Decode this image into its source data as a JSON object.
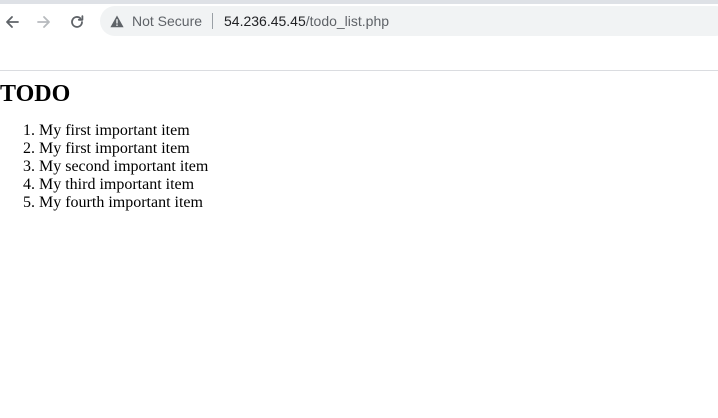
{
  "browser": {
    "security_label": "Not Secure",
    "url_host": "54.236.45.45",
    "url_path": "/todo_list.php",
    "icons": {
      "back": "arrow-left-icon",
      "forward": "arrow-right-icon",
      "reload": "reload-icon",
      "security": "warning-triangle-icon"
    }
  },
  "page": {
    "heading": "TODO",
    "items": [
      "My first important item",
      "My first important item",
      "My second important item",
      "My third important item",
      "My fourth important item"
    ]
  }
}
